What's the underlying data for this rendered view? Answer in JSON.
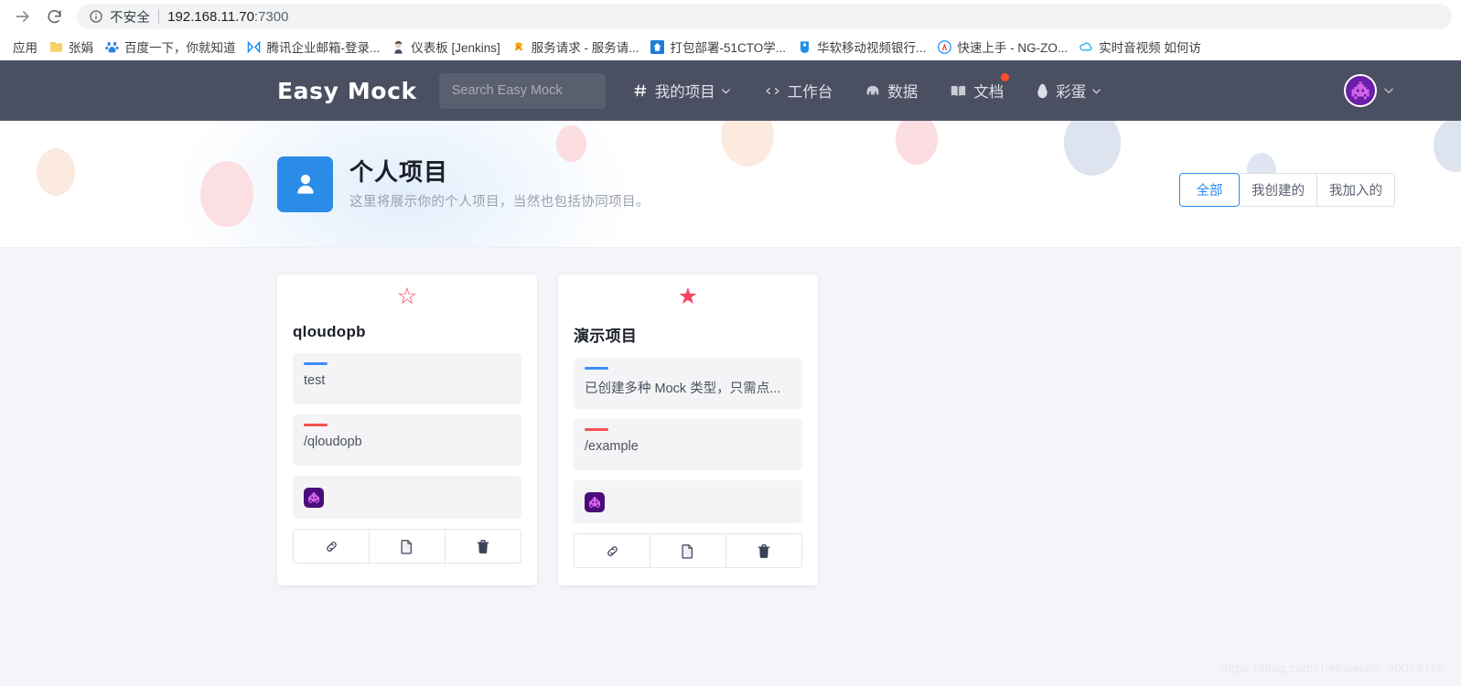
{
  "browser": {
    "forward_icon": "forward-arrow-icon",
    "reload_icon": "reload-icon",
    "info_icon": "info-circle-icon",
    "security_label": "不安全",
    "url_host": "192.168.11.70",
    "url_port": ":7300",
    "bookmarks": [
      {
        "label": "应用",
        "icon": "apps-icon",
        "glyph": ""
      },
      {
        "label": "张娟",
        "icon": "folder-icon",
        "glyph": ""
      },
      {
        "label": "百度一下，你就知道",
        "icon": "baidu-icon",
        "glyph": "熊"
      },
      {
        "label": "腾讯企业邮箱-登录...",
        "icon": "tencent-exmail-icon",
        "glyph": "✉"
      },
      {
        "label": "仪表板 [Jenkins]",
        "icon": "jenkins-icon",
        "glyph": "J"
      },
      {
        "label": "服务请求 - 服务请...",
        "icon": "service-request-icon",
        "glyph": "✿"
      },
      {
        "label": "打包部署-51CTO学...",
        "icon": "cto51-icon",
        "glyph": "⌂"
      },
      {
        "label": "华软移动视频银行...",
        "icon": "huaruan-video-bank-icon",
        "glyph": "❂"
      },
      {
        "label": "快速上手 - NG-ZO...",
        "icon": "ng-zorro-icon",
        "glyph": "A"
      },
      {
        "label": "实时音视频 如何访",
        "icon": "realtime-av-icon",
        "glyph": "☁"
      }
    ]
  },
  "navbar": {
    "brand": "Easy Mock",
    "search_placeholder": "Search Easy Mock",
    "links": [
      {
        "label": "我的项目",
        "icon": "hash-icon",
        "glyph": "#",
        "chevron": true,
        "badge": false
      },
      {
        "label": "工作台",
        "icon": "code-brackets-icon",
        "glyph": "↔",
        "chevron": false,
        "badge": false
      },
      {
        "label": "数据",
        "icon": "database-icon",
        "glyph": "▣",
        "chevron": false,
        "badge": false
      },
      {
        "label": "文档",
        "icon": "book-icon",
        "glyph": "▥",
        "chevron": false,
        "badge": true
      },
      {
        "label": "彩蛋",
        "icon": "egg-icon",
        "glyph": "◗",
        "chevron": true,
        "badge": false
      }
    ],
    "avatar_name": "user-avatar-identicon",
    "avatar_chevron_icon": "chevron-down-icon"
  },
  "hero": {
    "icon_name": "person-avatar-icon",
    "title": "个人项目",
    "subtitle": "这里将展示你的个人项目，当然也包括协同项目。",
    "filters": [
      {
        "label": "全部",
        "active": true
      },
      {
        "label": "我创建的",
        "active": false
      },
      {
        "label": "我加入的",
        "active": false
      }
    ]
  },
  "projects": [
    {
      "name": "qloudopb",
      "starred": false,
      "star_glyph": "☆",
      "description": "test",
      "base_url": "/qloudopb",
      "members": 1,
      "actions": [
        {
          "name": "copy-link-action",
          "glyph": "🔗"
        },
        {
          "name": "clone-project-action",
          "glyph": "📋"
        },
        {
          "name": "delete-project-action",
          "glyph": "🗑"
        }
      ]
    },
    {
      "name": "演示项目",
      "starred": true,
      "star_glyph": "★",
      "description": "已创建多种 Mock 类型，只需点...",
      "base_url": "/example",
      "members": 1,
      "actions": [
        {
          "name": "copy-link-action",
          "glyph": "🔗"
        },
        {
          "name": "clone-project-action",
          "glyph": "📋"
        },
        {
          "name": "delete-project-action",
          "glyph": "🗑"
        }
      ]
    }
  ],
  "watermark": "https://blog.csdn.net/weixin_40073115",
  "colors": {
    "navbar_bg": "#4a4f61",
    "page_bg": "#f4f5f9",
    "accent_blue": "#2d8cf0",
    "hero_icon_blue": "#2b8ce8",
    "star_red": "#f5475f",
    "field_blue": "#3e8ef7",
    "field_red": "#f2514f",
    "badge_red": "#ff4d2d",
    "avatar_purple": "#6b1fa8"
  }
}
